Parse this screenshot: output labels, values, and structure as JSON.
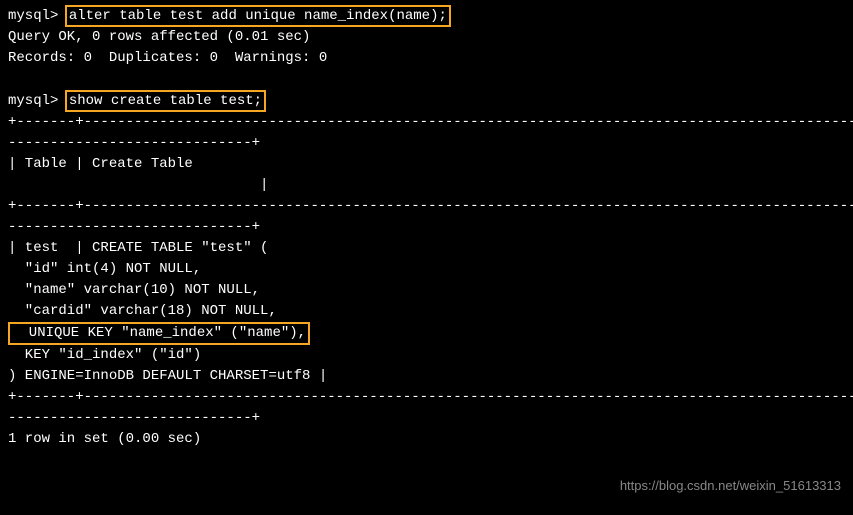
{
  "prompt": "mysql> ",
  "cmd1": "alter table test add unique name_index(name);",
  "result1_line1": "Query OK, 0 rows affected (0.01 sec)",
  "result1_line2": "Records: 0  Duplicates: 0  Warnings: 0",
  "cmd2": "show create table test;",
  "sep1": "+-------+----------------------------------------------------------------------------------------------------",
  "sep2": "-----------------------------+",
  "header": "| Table | Create Table",
  "header_pad": "                              |",
  "ct_line1": "| test  | CREATE TABLE \"test\" (",
  "ct_line2": "  \"id\" int(4) NOT NULL,",
  "ct_line3": "  \"name\" varchar(10) NOT NULL,",
  "ct_line4": "  \"cardid\" varchar(18) NOT NULL,",
  "ct_line5_hl": "  UNIQUE KEY \"name_index\" (\"name\"),",
  "ct_line6": "  KEY \"id_index\" (\"id\")",
  "ct_line7": ") ENGINE=InnoDB DEFAULT CHARSET=utf8 |",
  "footer": "1 row in set (0.00 sec)",
  "watermark": "https://blog.csdn.net/weixin_51613313"
}
